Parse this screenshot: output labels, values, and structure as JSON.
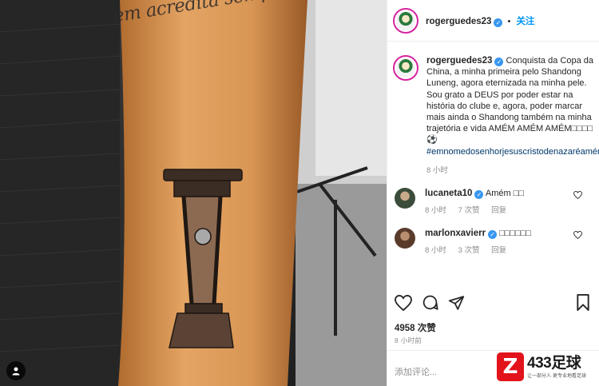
{
  "photo": {
    "tattoo_text": "em acredita sempre alcança",
    "alt": "tattoo"
  },
  "header": {
    "username": "rogerguedes23",
    "verified": "✓",
    "separator": "•",
    "follow_label": "关注"
  },
  "caption": {
    "username": "rogerguedes23",
    "text": "Conquista da Copa da China, a minha primeira pelo Shandong Luneng, agora eternizada na minha pele. Sou grato a DEUS por poder estar na história do clube e, agora, poder marcar mais ainda o Shandong também na minha trajetória e vida AMÉM AMÉM AMÉM□□□□⚽",
    "hashtag": "#emnomedosenhorjesuscristodenazaréamémamémamém",
    "time": "8 小时"
  },
  "comments": [
    {
      "username": "lucaneta10",
      "text": "Amém □□",
      "time": "8 小时",
      "likes": "7 次赞",
      "reply": "回复"
    },
    {
      "username": "marlonxavierr",
      "text": "□□□□□□",
      "time": "8 小时",
      "likes": "3 次赞",
      "reply": "回复"
    }
  ],
  "likes": "4958 次赞",
  "age": "8 小时前",
  "add_comment_placeholder": "添加评论...",
  "watermark": {
    "logo": "Z",
    "big": "433足球",
    "small": "让一部分人·更专业地看足球"
  },
  "colors": {
    "follow": "#0095f6",
    "hashtag": "#00376b",
    "verified": "#3897f0",
    "watermark": "#e3131b"
  }
}
